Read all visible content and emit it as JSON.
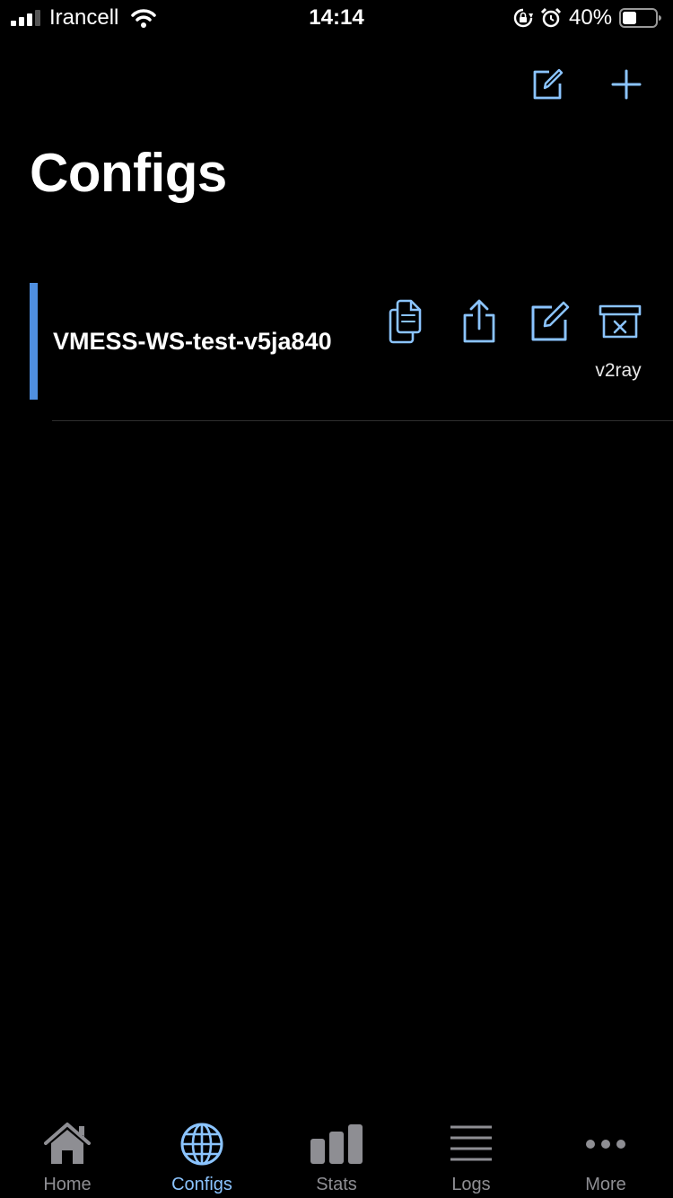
{
  "status_bar": {
    "carrier": "Irancell",
    "time": "14:14",
    "battery": "40%"
  },
  "header": {
    "title": "Configs",
    "actions": [
      {
        "icon": "edit-icon"
      },
      {
        "icon": "plus-icon"
      }
    ]
  },
  "configs": [
    {
      "name": "VMESS-WS-test-v5ja840",
      "type": "v2ray",
      "actions": [
        "copy-icon",
        "share-icon",
        "edit-icon",
        "delete-icon"
      ]
    }
  ],
  "tabs": [
    {
      "label": "Home",
      "icon": "home-icon",
      "active": false
    },
    {
      "label": "Configs",
      "icon": "globe-icon",
      "active": true
    },
    {
      "label": "Stats",
      "icon": "bar-chart-icon",
      "active": false
    },
    {
      "label": "Logs",
      "icon": "list-icon",
      "active": false
    },
    {
      "label": "More",
      "icon": "more-icon",
      "active": false
    }
  ],
  "colors": {
    "accent": "#8bc4ff",
    "selected_bar": "#4f8fe0",
    "background": "#000000",
    "inactive": "#8e8e93"
  }
}
